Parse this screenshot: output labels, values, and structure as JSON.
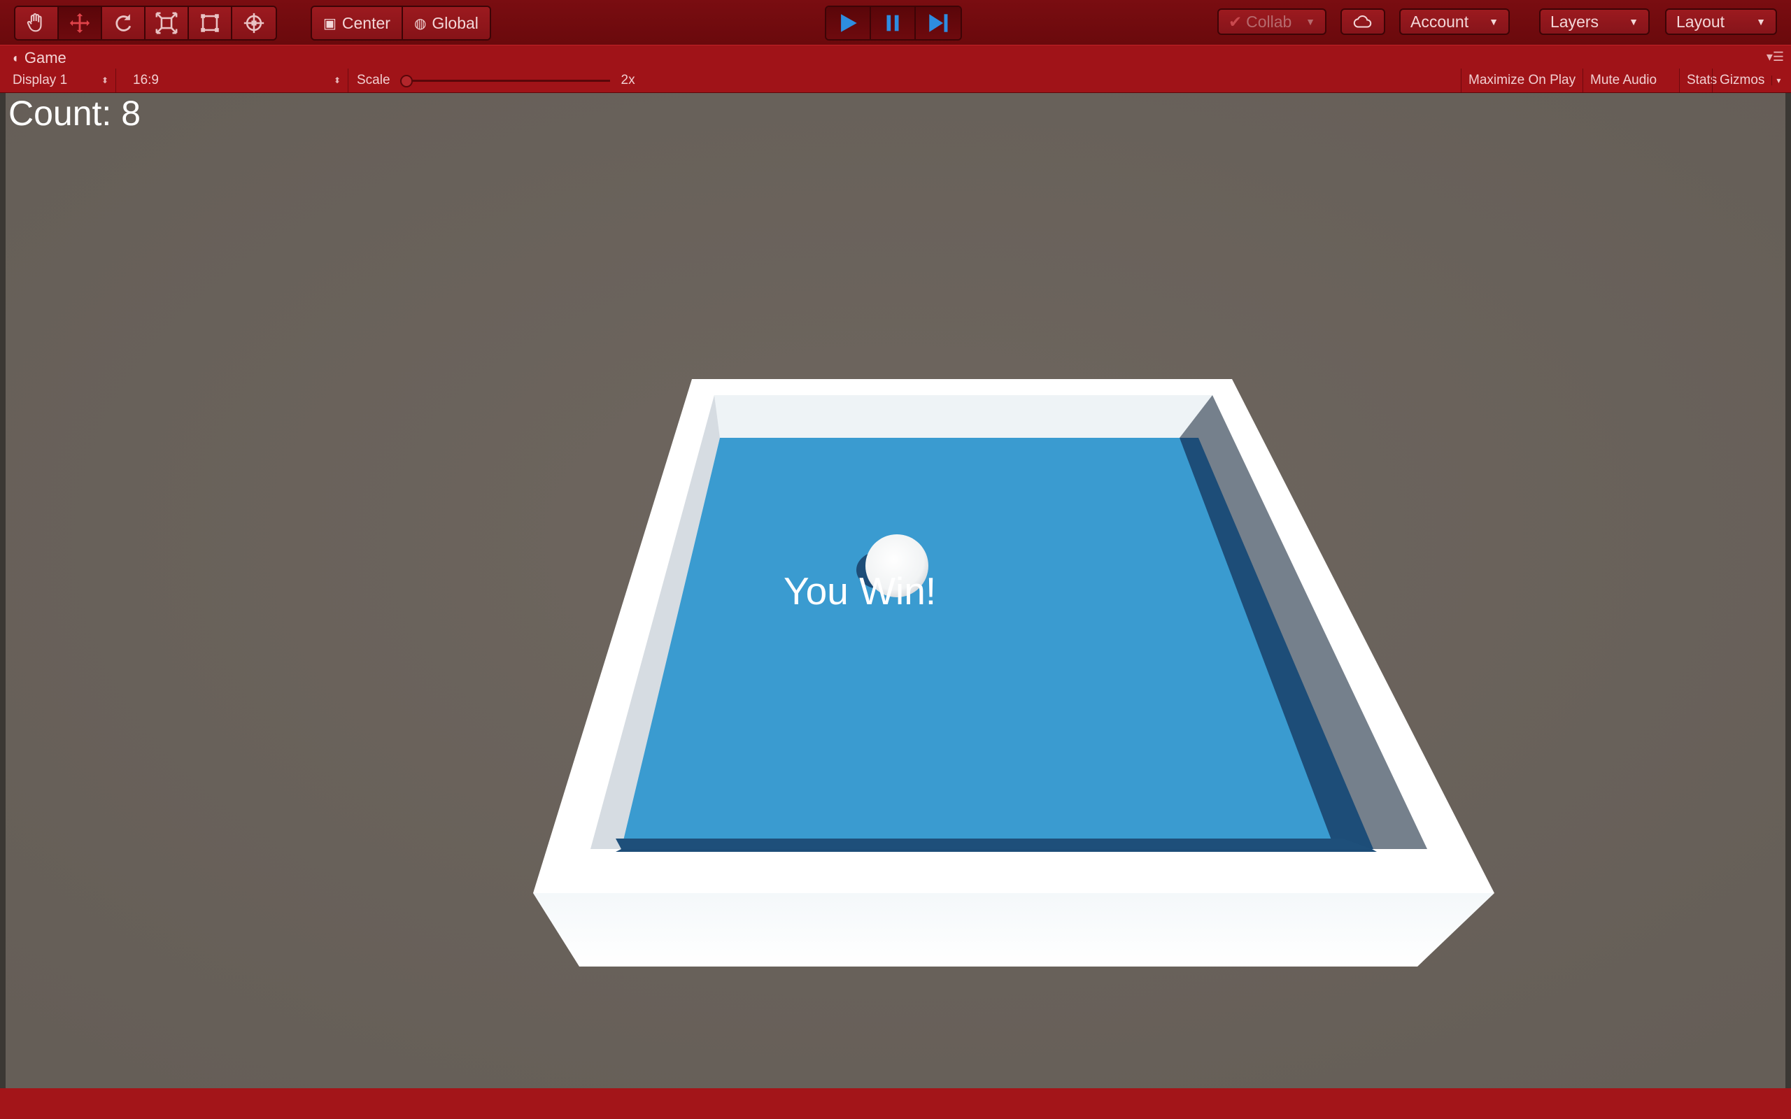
{
  "toolbar": {
    "tools": [
      {
        "name": "hand-tool",
        "icon": "hand-icon"
      },
      {
        "name": "move-tool",
        "icon": "move-arrows-icon"
      },
      {
        "name": "rotate-tool",
        "icon": "rotate-icon"
      },
      {
        "name": "scale-tool",
        "icon": "scale-icon"
      },
      {
        "name": "rect-tool",
        "icon": "rect-transform-icon"
      },
      {
        "name": "transform-tool",
        "icon": "transform-icon"
      }
    ],
    "center_label": "Center",
    "global_label": "Global",
    "collab_label": "Collab",
    "account_label": "Account",
    "layers_label": "Layers",
    "layout_label": "Layout"
  },
  "tab": {
    "title": "Game"
  },
  "game_controls": {
    "display": "Display 1",
    "aspect": "16:9",
    "scale_label": "Scale",
    "scale_value": "2x",
    "maximize": "Maximize On Play",
    "mute": "Mute Audio",
    "stats": "Stats",
    "gizmos": "Gizmos"
  },
  "game": {
    "count_text": "Count: 8",
    "win_text": "You Win!"
  },
  "colors": {
    "playmode_tint": "#a01318",
    "floor": "#3a9bd0",
    "wall": "#ffffff",
    "background": "#6a635c"
  }
}
